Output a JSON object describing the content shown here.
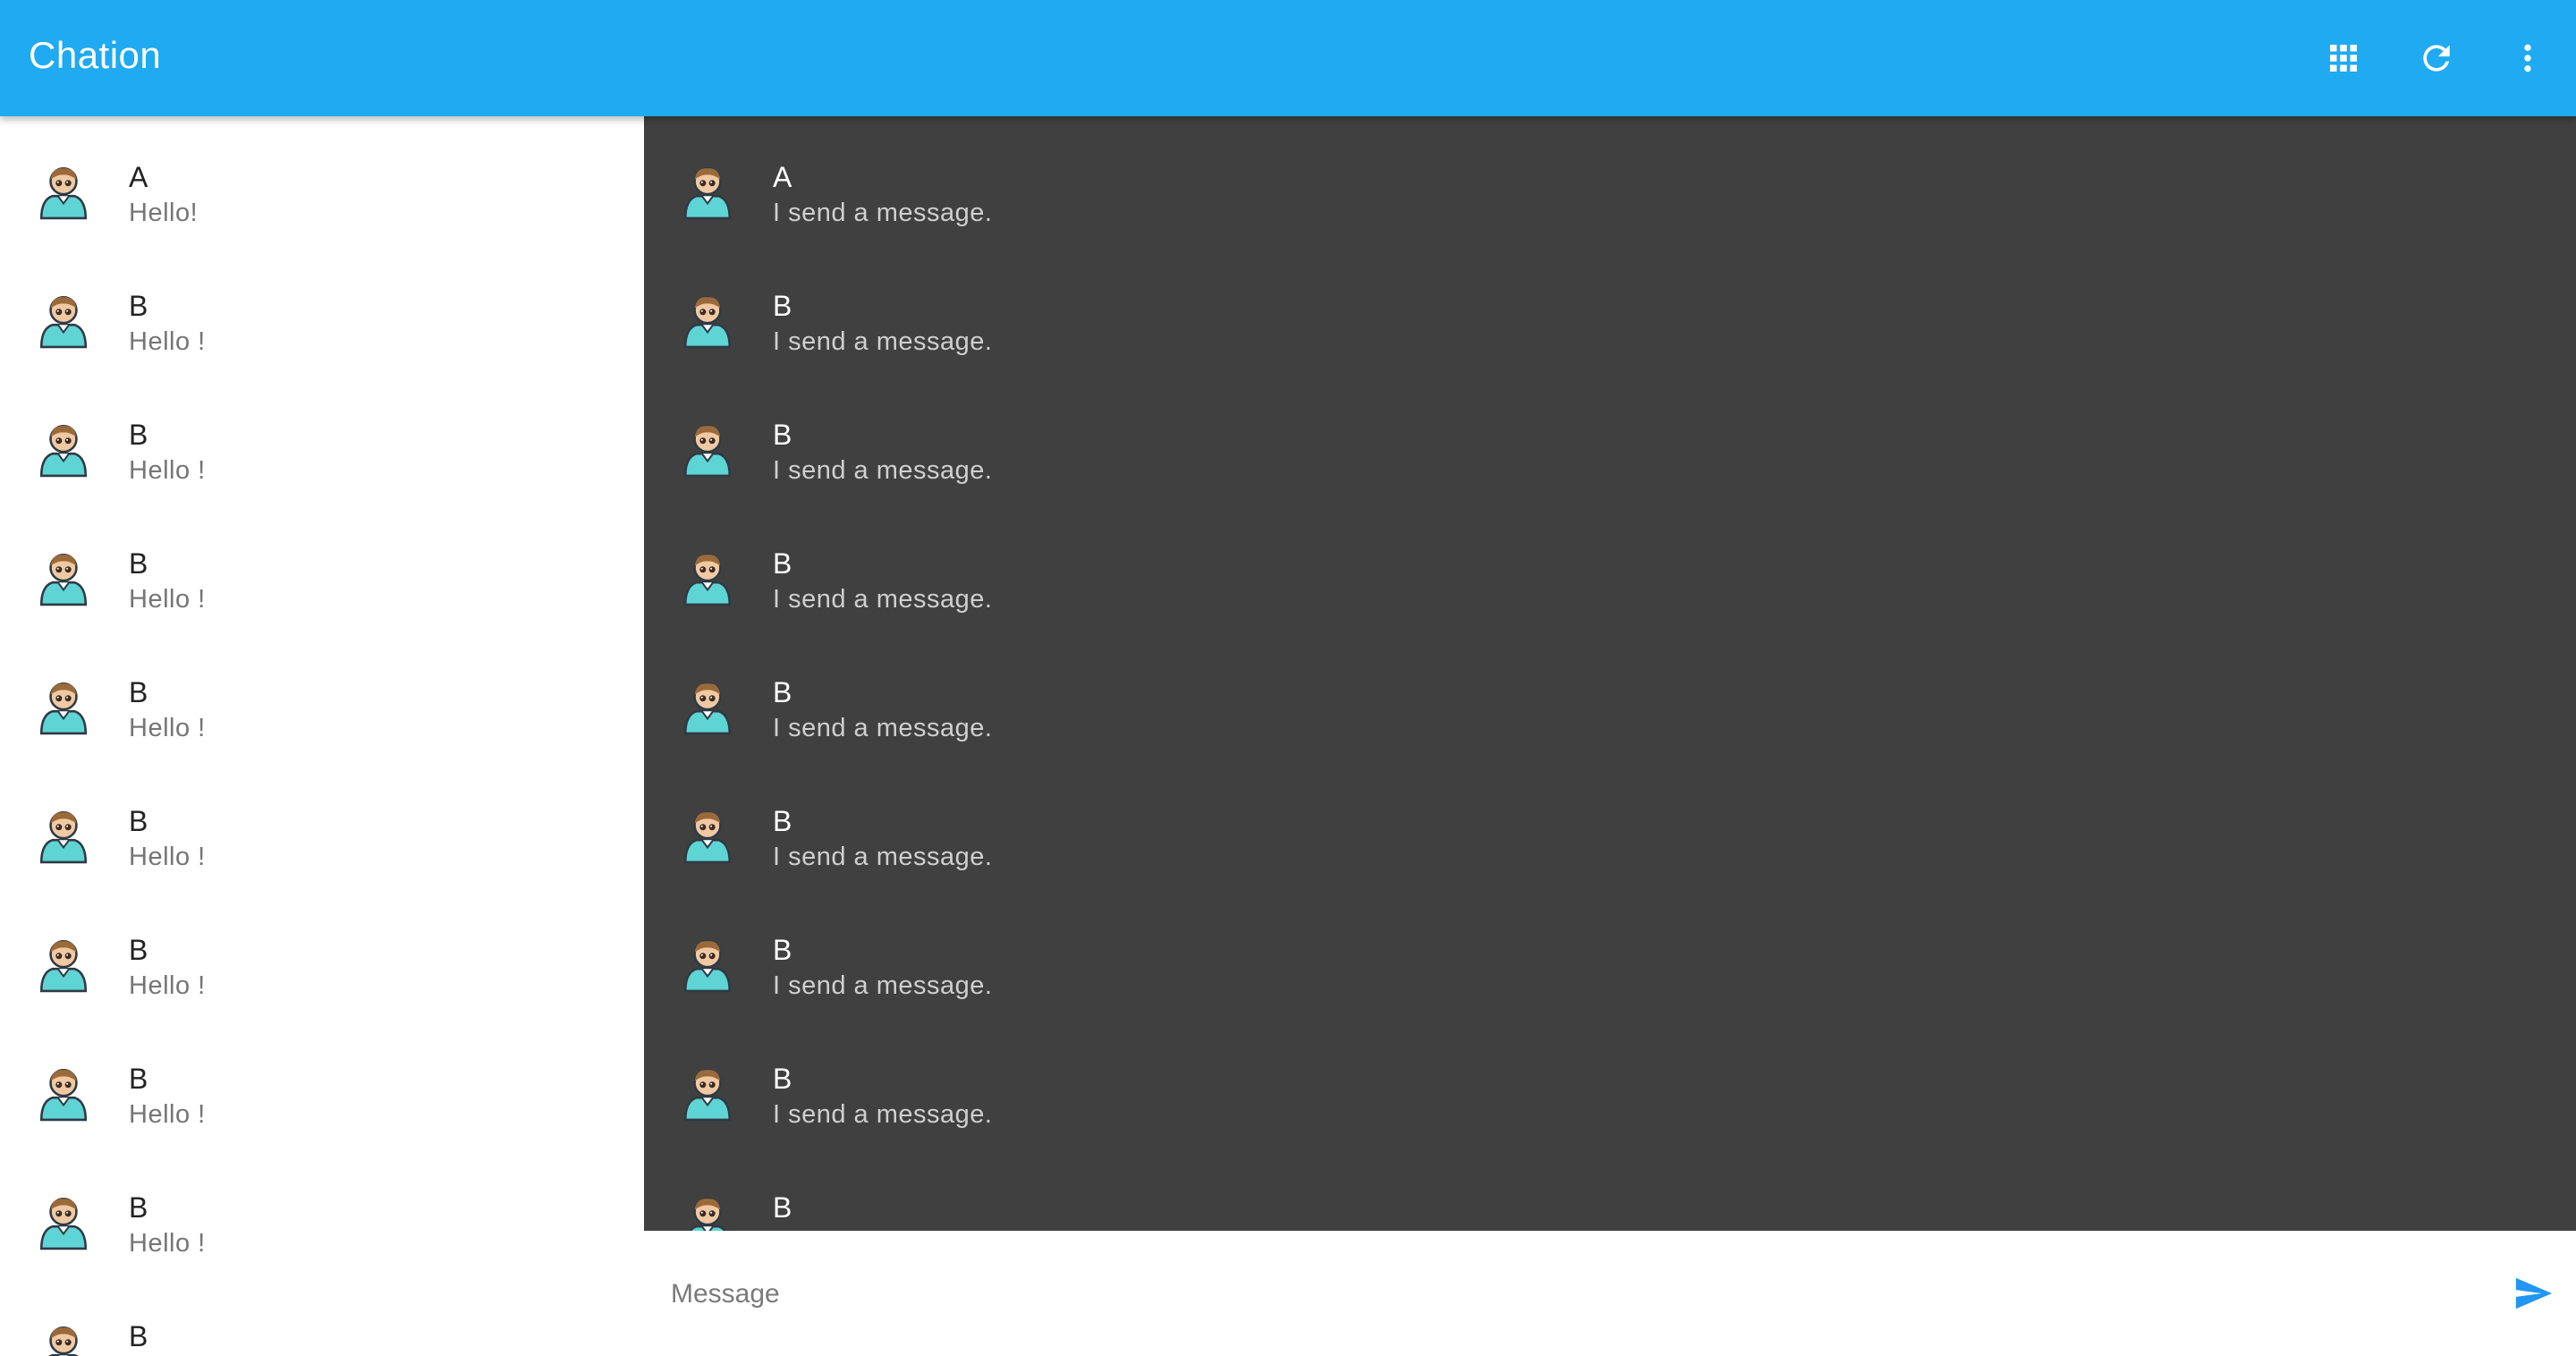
{
  "app": {
    "title": "Chation",
    "actions": [
      {
        "name": "apps-grid-icon"
      },
      {
        "name": "refresh-icon"
      },
      {
        "name": "more-vert-icon"
      }
    ]
  },
  "colors": {
    "appbar": "#1faaf1",
    "chat_background": "#404040",
    "avatar_body": "#5fd4d4",
    "send_icon": "#2196f3"
  },
  "conversations": [
    {
      "name": "A",
      "preview": "Hello!"
    },
    {
      "name": "B",
      "preview": "Hello !"
    },
    {
      "name": "B",
      "preview": "Hello !"
    },
    {
      "name": "B",
      "preview": "Hello !"
    },
    {
      "name": "B",
      "preview": "Hello !"
    },
    {
      "name": "B",
      "preview": "Hello !"
    },
    {
      "name": "B",
      "preview": "Hello !"
    },
    {
      "name": "B",
      "preview": "Hello !"
    },
    {
      "name": "B",
      "preview": "Hello !"
    },
    {
      "name": "B",
      "preview": ""
    }
  ],
  "messages": [
    {
      "sender": "A",
      "text": "I send a message."
    },
    {
      "sender": "B",
      "text": "I send a message."
    },
    {
      "sender": "B",
      "text": "I send a message."
    },
    {
      "sender": "B",
      "text": "I send a message."
    },
    {
      "sender": "B",
      "text": "I send a message."
    },
    {
      "sender": "B",
      "text": "I send a message."
    },
    {
      "sender": "B",
      "text": "I send a message."
    },
    {
      "sender": "B",
      "text": "I send a message."
    },
    {
      "sender": "B",
      "text": ""
    }
  ],
  "composer": {
    "placeholder": "Message",
    "value": ""
  }
}
